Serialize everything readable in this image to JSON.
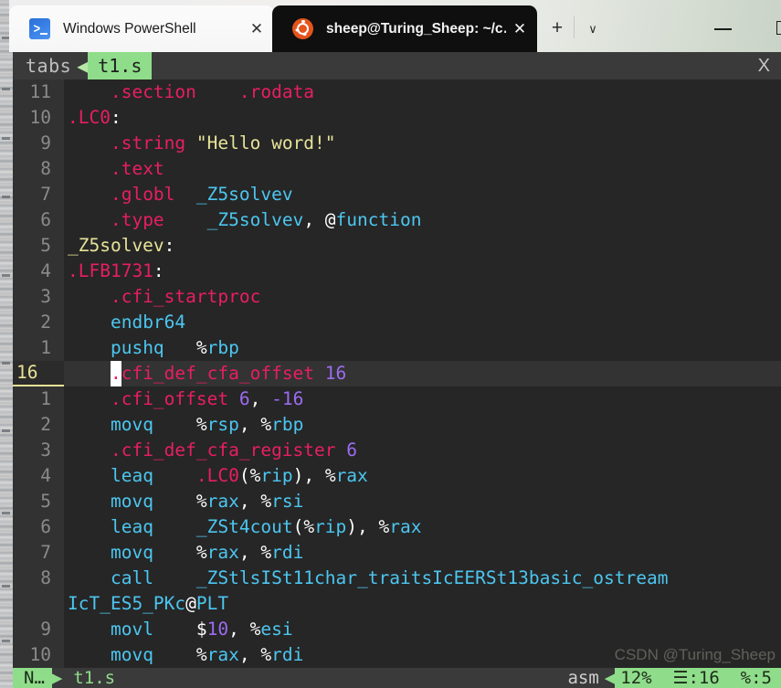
{
  "window": {
    "tabs": [
      {
        "title": "Windows PowerShell",
        "icon": "powershell-icon",
        "close": "✕",
        "active": false
      },
      {
        "title": "sheep@Turing_Sheep: ~/c…",
        "icon": "ubuntu-icon",
        "close": "✕",
        "active": true
      }
    ],
    "new_tab_label": "+",
    "tab_menu_label": "∨",
    "minimize_label": "",
    "maximize_label": ""
  },
  "vim": {
    "tabline": {
      "label": "tabs",
      "separator": "◀",
      "filename": "t1.s",
      "close": "X"
    },
    "lines": [
      {
        "num": "11",
        "cursor": false,
        "spans": [
          {
            "t": "    ",
            "c": "c-plain"
          },
          {
            "t": ".section",
            "c": "c-dir"
          },
          {
            "t": "    ",
            "c": "c-plain"
          },
          {
            "t": ".rodata",
            "c": "c-dir"
          }
        ]
      },
      {
        "num": "10",
        "cursor": false,
        "spans": [
          {
            "t": ".LC0",
            "c": "c-dir"
          },
          {
            "t": ":",
            "c": "c-plain"
          }
        ]
      },
      {
        "num": "9",
        "cursor": false,
        "spans": [
          {
            "t": "    ",
            "c": "c-plain"
          },
          {
            "t": ".string",
            "c": "c-dir"
          },
          {
            "t": " ",
            "c": "c-plain"
          },
          {
            "t": "\"Hello word!\"",
            "c": "c-str"
          }
        ]
      },
      {
        "num": "8",
        "cursor": false,
        "spans": [
          {
            "t": "    ",
            "c": "c-plain"
          },
          {
            "t": ".text",
            "c": "c-dir"
          }
        ]
      },
      {
        "num": "7",
        "cursor": false,
        "spans": [
          {
            "t": "    ",
            "c": "c-plain"
          },
          {
            "t": ".globl",
            "c": "c-dir"
          },
          {
            "t": "  ",
            "c": "c-plain"
          },
          {
            "t": "_Z5solvev",
            "c": "c-id"
          }
        ]
      },
      {
        "num": "6",
        "cursor": false,
        "spans": [
          {
            "t": "    ",
            "c": "c-plain"
          },
          {
            "t": ".type",
            "c": "c-dir"
          },
          {
            "t": "    ",
            "c": "c-plain"
          },
          {
            "t": "_Z5solvev",
            "c": "c-id"
          },
          {
            "t": ", @",
            "c": "c-plain"
          },
          {
            "t": "function",
            "c": "c-id"
          }
        ]
      },
      {
        "num": "5",
        "cursor": false,
        "spans": [
          {
            "t": "_Z5solvev",
            "c": "c-str"
          },
          {
            "t": ":",
            "c": "c-plain"
          }
        ]
      },
      {
        "num": "4",
        "cursor": false,
        "spans": [
          {
            "t": ".LFB1731",
            "c": "c-dir"
          },
          {
            "t": ":",
            "c": "c-plain"
          }
        ]
      },
      {
        "num": "3",
        "cursor": false,
        "spans": [
          {
            "t": "    ",
            "c": "c-plain"
          },
          {
            "t": ".cfi_startproc",
            "c": "c-dir"
          }
        ]
      },
      {
        "num": "2",
        "cursor": false,
        "spans": [
          {
            "t": "    ",
            "c": "c-plain"
          },
          {
            "t": "endbr64",
            "c": "c-id"
          }
        ]
      },
      {
        "num": "1",
        "cursor": false,
        "spans": [
          {
            "t": "    ",
            "c": "c-plain"
          },
          {
            "t": "pushq",
            "c": "c-id"
          },
          {
            "t": "   %",
            "c": "c-plain"
          },
          {
            "t": "rbp",
            "c": "c-id"
          }
        ]
      },
      {
        "num": "16",
        "cursor": true,
        "spans": [
          {
            "t": "    ",
            "c": "c-plain"
          },
          {
            "t": ".",
            "c": "cursor-blk"
          },
          {
            "t": "cfi_def_cfa_offset",
            "c": "c-dir"
          },
          {
            "t": " ",
            "c": "c-plain"
          },
          {
            "t": "16",
            "c": "c-num"
          }
        ]
      },
      {
        "num": "1",
        "cursor": false,
        "spans": [
          {
            "t": "    ",
            "c": "c-plain"
          },
          {
            "t": ".cfi_offset",
            "c": "c-dir"
          },
          {
            "t": " ",
            "c": "c-plain"
          },
          {
            "t": "6",
            "c": "c-num"
          },
          {
            "t": ", ",
            "c": "c-plain"
          },
          {
            "t": "-16",
            "c": "c-num"
          }
        ]
      },
      {
        "num": "2",
        "cursor": false,
        "spans": [
          {
            "t": "    ",
            "c": "c-plain"
          },
          {
            "t": "movq",
            "c": "c-id"
          },
          {
            "t": "    %",
            "c": "c-plain"
          },
          {
            "t": "rsp",
            "c": "c-id"
          },
          {
            "t": ", %",
            "c": "c-plain"
          },
          {
            "t": "rbp",
            "c": "c-id"
          }
        ]
      },
      {
        "num": "3",
        "cursor": false,
        "spans": [
          {
            "t": "    ",
            "c": "c-plain"
          },
          {
            "t": ".cfi_def_cfa_register",
            "c": "c-dir"
          },
          {
            "t": " ",
            "c": "c-plain"
          },
          {
            "t": "6",
            "c": "c-num"
          }
        ]
      },
      {
        "num": "4",
        "cursor": false,
        "spans": [
          {
            "t": "    ",
            "c": "c-plain"
          },
          {
            "t": "leaq",
            "c": "c-id"
          },
          {
            "t": "    ",
            "c": "c-plain"
          },
          {
            "t": ".LC0",
            "c": "c-dir"
          },
          {
            "t": "(%",
            "c": "c-plain"
          },
          {
            "t": "rip",
            "c": "c-id"
          },
          {
            "t": "), %",
            "c": "c-plain"
          },
          {
            "t": "rax",
            "c": "c-id"
          }
        ]
      },
      {
        "num": "5",
        "cursor": false,
        "spans": [
          {
            "t": "    ",
            "c": "c-plain"
          },
          {
            "t": "movq",
            "c": "c-id"
          },
          {
            "t": "    %",
            "c": "c-plain"
          },
          {
            "t": "rax",
            "c": "c-id"
          },
          {
            "t": ", %",
            "c": "c-plain"
          },
          {
            "t": "rsi",
            "c": "c-id"
          }
        ]
      },
      {
        "num": "6",
        "cursor": false,
        "spans": [
          {
            "t": "    ",
            "c": "c-plain"
          },
          {
            "t": "leaq",
            "c": "c-id"
          },
          {
            "t": "    ",
            "c": "c-plain"
          },
          {
            "t": "_ZSt4cout",
            "c": "c-id"
          },
          {
            "t": "(%",
            "c": "c-plain"
          },
          {
            "t": "rip",
            "c": "c-id"
          },
          {
            "t": "), %",
            "c": "c-plain"
          },
          {
            "t": "rax",
            "c": "c-id"
          }
        ]
      },
      {
        "num": "7",
        "cursor": false,
        "spans": [
          {
            "t": "    ",
            "c": "c-plain"
          },
          {
            "t": "movq",
            "c": "c-id"
          },
          {
            "t": "    %",
            "c": "c-plain"
          },
          {
            "t": "rax",
            "c": "c-id"
          },
          {
            "t": ", %",
            "c": "c-plain"
          },
          {
            "t": "rdi",
            "c": "c-id"
          }
        ]
      },
      {
        "num": "8",
        "cursor": false,
        "spans": [
          {
            "t": "    ",
            "c": "c-plain"
          },
          {
            "t": "call",
            "c": "c-id"
          },
          {
            "t": "    ",
            "c": "c-plain"
          },
          {
            "t": "_ZStlsISt11char_traitsIcEERSt13basic_ostream",
            "c": "c-id"
          }
        ]
      },
      {
        "num": "",
        "cursor": false,
        "wrapped": true,
        "spans": [
          {
            "t": "IcT_ES5_PKc",
            "c": "c-id"
          },
          {
            "t": "@",
            "c": "c-plain"
          },
          {
            "t": "PLT",
            "c": "c-id"
          }
        ]
      },
      {
        "num": "9",
        "cursor": false,
        "spans": [
          {
            "t": "    ",
            "c": "c-plain"
          },
          {
            "t": "movl",
            "c": "c-id"
          },
          {
            "t": "    $",
            "c": "c-plain"
          },
          {
            "t": "10",
            "c": "c-num"
          },
          {
            "t": ", %",
            "c": "c-plain"
          },
          {
            "t": "esi",
            "c": "c-id"
          }
        ]
      },
      {
        "num": "10",
        "cursor": false,
        "spans": [
          {
            "t": "    ",
            "c": "c-plain"
          },
          {
            "t": "movq",
            "c": "c-id"
          },
          {
            "t": "    %",
            "c": "c-plain"
          },
          {
            "t": "rax",
            "c": "c-id"
          },
          {
            "t": ", %",
            "c": "c-plain"
          },
          {
            "t": "rdi",
            "c": "c-id"
          }
        ]
      }
    ],
    "statusline": {
      "mode": "N…",
      "arrow_left": "▶",
      "filename": "t1.s",
      "filetype": "asm",
      "arrow_right": "◀",
      "position": "12%  ☰:16  %:5"
    }
  },
  "watermark": "CSDN @Turing_Sheep",
  "colors": {
    "accent_green": "#8fdd8a",
    "directive_pink": "#e81e63",
    "identifier_cyan": "#4cc6f0",
    "string_yellow": "#e6e398",
    "number_purple": "#9b6cf0",
    "terminal_bg": "#262626",
    "gutter_bg": "#323232"
  }
}
